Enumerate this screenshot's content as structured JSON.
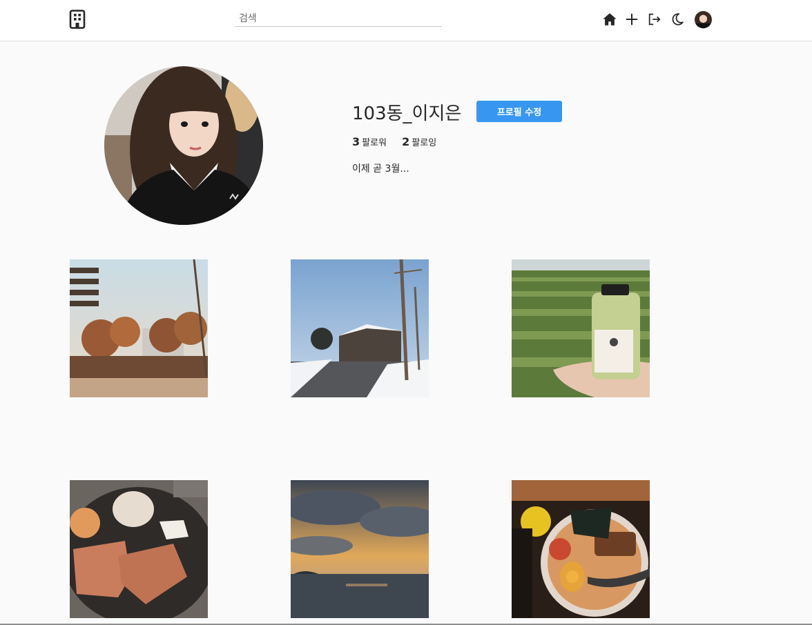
{
  "search": {
    "placeholder": "검색"
  },
  "nav": {
    "icons": [
      "building-logo-icon",
      "home-icon",
      "plus-icon",
      "logout-icon",
      "moon-icon"
    ]
  },
  "profile": {
    "username": "103동_이지은",
    "edit_button": "프로필 수정",
    "followers": {
      "count": "3",
      "label": "팔로워"
    },
    "following": {
      "count": "2",
      "label": "팔로잉"
    },
    "bio": "이제 곧 3월..."
  },
  "posts": [
    "autumn-street-photo",
    "snowy-town-photo",
    "green-tea-field-bottle-photo",
    "tonkatsu-plate-photo",
    "sunset-sea-photo",
    "ramen-bowl-photo"
  ],
  "colors": {
    "accent": "#3797f0",
    "background": "#fafafa",
    "border": "#dbdbdb"
  }
}
